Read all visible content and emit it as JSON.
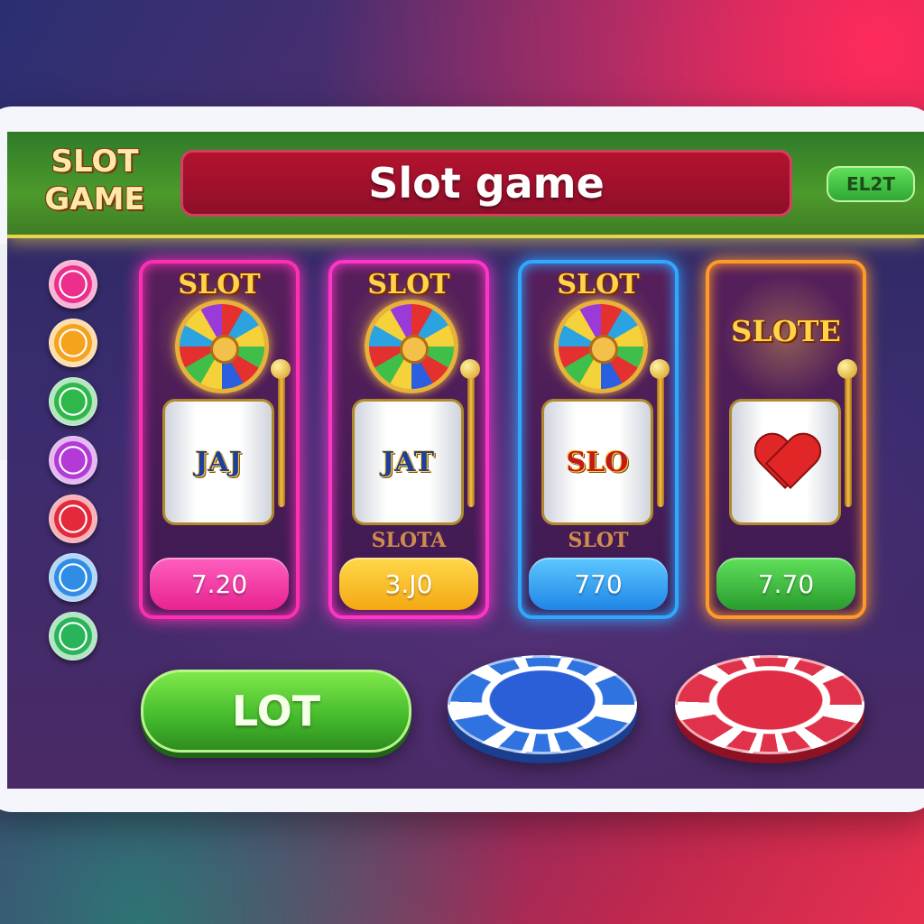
{
  "header": {
    "logo_line1": "SLOT",
    "logo_line2": "GAME",
    "title": "Slot game",
    "badge": "EL2T"
  },
  "side_chips": [
    {
      "color": "#ec2e8c"
    },
    {
      "color": "#f5a21c"
    },
    {
      "color": "#2fb84a"
    },
    {
      "color": "#b43ad8"
    },
    {
      "color": "#e42a3a"
    },
    {
      "color": "#2f8de6"
    },
    {
      "color": "#29b45a"
    }
  ],
  "machines": [
    {
      "top_title": "SLOT",
      "reel_symbol": "JAJ",
      "bottom_label": "",
      "win_value": "7.20",
      "glow": "#ff2fb4",
      "pill_top": "#ff5fbf",
      "pill_bottom": "#e8238f"
    },
    {
      "top_title": "SLOT",
      "reel_symbol": "JAT",
      "bottom_label": "SLOTA",
      "win_value": "3.J0",
      "glow": "#ff35c8",
      "pill_top": "#ffd84a",
      "pill_bottom": "#f4a812"
    },
    {
      "top_title": "SLOT",
      "reel_symbol": "SLO",
      "bottom_label": "SLOT",
      "win_value": "770",
      "glow": "#2fa8ff",
      "pill_top": "#5ec7ff",
      "pill_bottom": "#1f86e6"
    },
    {
      "top_title": "SLOTE",
      "reel_symbol": "heart",
      "bottom_label": "",
      "win_value": "7.70",
      "glow": "#ff9a2a",
      "pill_top": "#5fe05a",
      "pill_bottom": "#2a9c2e"
    }
  ],
  "controls": {
    "spin_label": "LOT",
    "chip_blue": {
      "color": "#2f73e0",
      "center": "#2a5fd8",
      "shadow": "#1a3f90"
    },
    "chip_red": {
      "color": "#e0324a",
      "center": "#e02c44",
      "shadow": "#8e1224"
    }
  }
}
